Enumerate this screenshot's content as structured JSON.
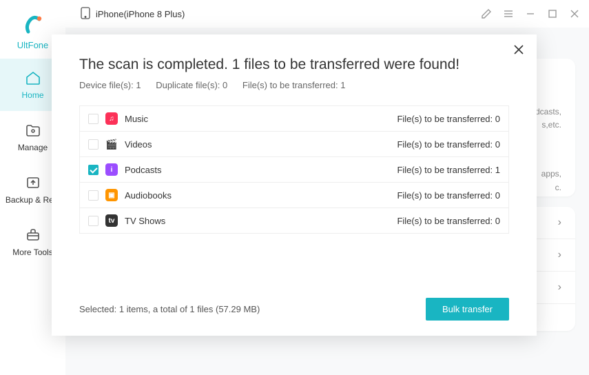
{
  "brand": "UltFone",
  "device": "iPhone(iPhone 8 Plus)",
  "sidebar": {
    "items": [
      {
        "label": "Home",
        "active": true
      },
      {
        "label": "Manage",
        "active": false
      },
      {
        "label": "Backup & Rest",
        "active": false
      },
      {
        "label": "More Tools",
        "active": false
      }
    ]
  },
  "bg": {
    "text1": "odcasts,\ns,etc.",
    "text2": "apps,\nc."
  },
  "modal": {
    "title": "The scan is completed. 1 files to be transferred were found!",
    "device_files": "Device file(s): 1",
    "duplicate_files": "Duplicate file(s): 0",
    "files_to_transfer": "File(s) to be transferred: 1",
    "transfer_label": "File(s) to be transferred:",
    "rows": [
      {
        "name": "Music",
        "count": 0,
        "checked": false,
        "iconClass": "icon-music",
        "glyph": "♫"
      },
      {
        "name": "Videos",
        "count": 0,
        "checked": false,
        "iconClass": "icon-videos",
        "glyph": "🎬"
      },
      {
        "name": "Podcasts",
        "count": 1,
        "checked": true,
        "iconClass": "icon-podcasts",
        "glyph": "i"
      },
      {
        "name": "Audiobooks",
        "count": 0,
        "checked": false,
        "iconClass": "icon-audiobooks",
        "glyph": "▣"
      },
      {
        "name": "TV Shows",
        "count": 0,
        "checked": false,
        "iconClass": "icon-tvshows",
        "glyph": "tv"
      }
    ],
    "selected_text": "Selected: 1 items, a total of 1 files (57.29 MB)",
    "bulk_button": "Bulk transfer"
  }
}
